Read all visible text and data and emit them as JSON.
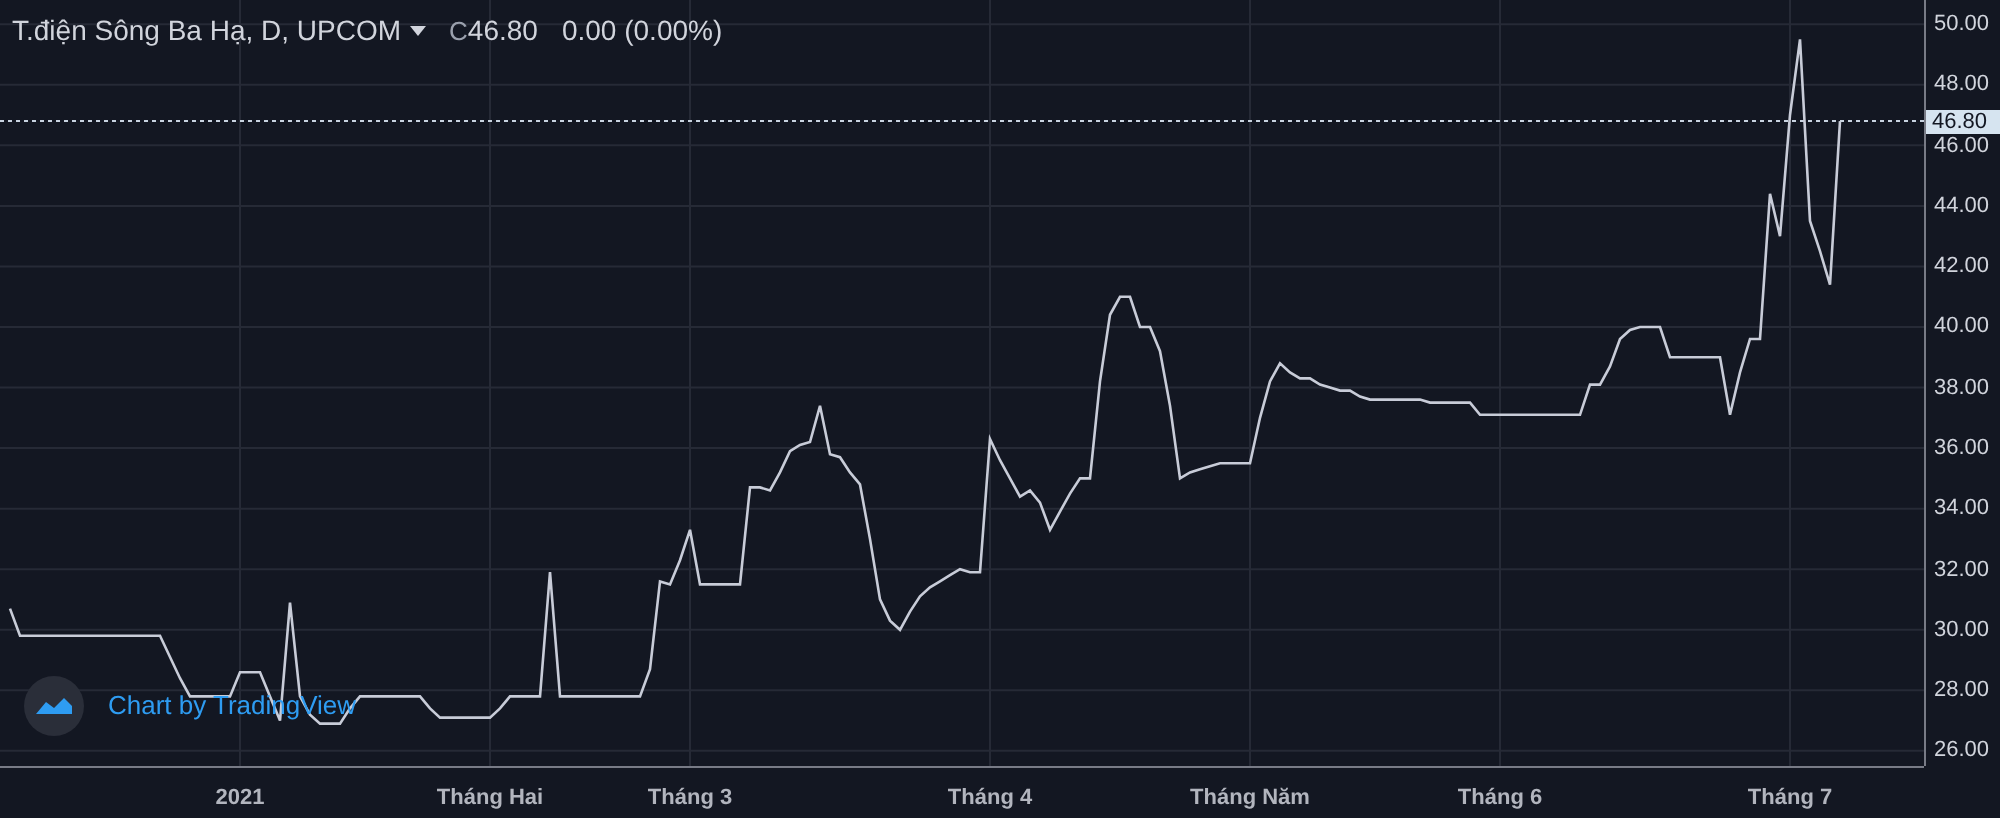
{
  "header": {
    "title": "T.điện Sông Ba Hạ, D, UPCOM",
    "close_prefix": "C",
    "close": "46.80",
    "change": "0.00 (0.00%)"
  },
  "price_label": "46.80",
  "attribution": "Chart by TradingView",
  "chart_data": {
    "type": "line",
    "grid": true,
    "ylim": [
      25.5,
      50.8
    ],
    "ref_lines": [
      {
        "axis": "y",
        "value": 46.8
      }
    ],
    "yticks": [
      {
        "value": 26,
        "label": "26.00"
      },
      {
        "value": 28,
        "label": "28.00"
      },
      {
        "value": 30,
        "label": "30.00"
      },
      {
        "value": 32,
        "label": "32.00"
      },
      {
        "value": 34,
        "label": "34.00"
      },
      {
        "value": 36,
        "label": "36.00"
      },
      {
        "value": 38,
        "label": "38.00"
      },
      {
        "value": 40,
        "label": "40.00"
      },
      {
        "value": 42,
        "label": "42.00"
      },
      {
        "value": 44,
        "label": "44.00"
      },
      {
        "value": 46,
        "label": "46.00"
      },
      {
        "value": 48,
        "label": "48.00"
      },
      {
        "value": 50,
        "label": "50.00"
      }
    ],
    "categories": [
      null,
      null,
      null,
      null,
      null,
      null,
      null,
      null,
      null,
      null,
      null,
      null,
      null,
      null,
      null,
      null,
      null,
      null,
      null,
      null,
      null,
      null,
      null,
      "2021",
      null,
      null,
      null,
      null,
      null,
      null,
      null,
      null,
      null,
      null,
      null,
      null,
      null,
      null,
      null,
      null,
      null,
      null,
      null,
      null,
      null,
      null,
      null,
      null,
      "Tháng Hai",
      null,
      null,
      null,
      null,
      null,
      null,
      null,
      null,
      null,
      null,
      null,
      null,
      null,
      null,
      null,
      null,
      null,
      null,
      null,
      "Tháng 3",
      null,
      null,
      null,
      null,
      null,
      null,
      null,
      null,
      null,
      null,
      null,
      null,
      null,
      null,
      null,
      null,
      null,
      null,
      null,
      null,
      null,
      null,
      null,
      null,
      null,
      null,
      null,
      null,
      null,
      "Tháng 4",
      null,
      null,
      null,
      null,
      null,
      null,
      null,
      null,
      null,
      null,
      null,
      null,
      null,
      null,
      null,
      null,
      null,
      null,
      null,
      null,
      null,
      null,
      null,
      null,
      null,
      "Tháng Năm",
      null,
      null,
      null,
      null,
      null,
      null,
      null,
      null,
      null,
      null,
      null,
      null,
      null,
      null,
      null,
      null,
      null,
      null,
      null,
      null,
      null,
      null,
      null,
      null,
      "Tháng 6",
      null,
      null,
      null,
      null,
      null,
      null,
      null,
      null,
      null,
      null,
      null,
      null,
      null,
      null,
      null,
      null,
      null,
      null,
      null,
      null,
      null,
      null,
      null,
      null,
      null,
      null,
      null,
      null,
      "Tháng 7",
      null,
      null,
      null,
      null,
      null
    ],
    "series": [
      {
        "color": "#c8ccd8",
        "values": [
          30.7,
          29.8,
          29.8,
          29.8,
          29.8,
          29.8,
          29.8,
          29.8,
          29.8,
          29.8,
          29.8,
          29.8,
          29.8,
          29.8,
          29.8,
          29.8,
          29.1,
          28.4,
          27.8,
          27.8,
          27.8,
          27.8,
          27.8,
          28.6,
          28.6,
          28.6,
          27.8,
          27,
          30.9,
          27.8,
          27.2,
          26.9,
          26.9,
          26.9,
          27.4,
          27.8,
          27.8,
          27.8,
          27.8,
          27.8,
          27.8,
          27.8,
          27.4,
          27.1,
          27.1,
          27.1,
          27.1,
          27.1,
          27.1,
          27.4,
          27.8,
          27.8,
          27.8,
          27.8,
          31.9,
          27.8,
          27.8,
          27.8,
          27.8,
          27.8,
          27.8,
          27.8,
          27.8,
          27.8,
          28.7,
          31.6,
          31.5,
          32.3,
          33.3,
          31.5,
          31.5,
          31.5,
          31.5,
          31.5,
          34.7,
          34.7,
          34.6,
          35.2,
          35.9,
          36.1,
          36.2,
          37.4,
          35.8,
          35.7,
          35.2,
          34.8,
          33,
          31,
          30.3,
          30,
          30.6,
          31.1,
          31.4,
          31.6,
          31.8,
          32,
          31.9,
          31.9,
          36.3,
          35.6,
          35,
          34.4,
          34.6,
          34.2,
          33.3,
          33.9,
          34.5,
          35,
          35,
          38.2,
          40.4,
          41,
          41,
          40,
          40,
          39.2,
          37.4,
          35,
          35.2,
          35.3,
          35.4,
          35.5,
          35.5,
          35.5,
          35.5,
          37,
          38.2,
          38.8,
          38.5,
          38.3,
          38.3,
          38.1,
          38,
          37.9,
          37.9,
          37.7,
          37.6,
          37.6,
          37.6,
          37.6,
          37.6,
          37.6,
          37.5,
          37.5,
          37.5,
          37.5,
          37.5,
          37.1,
          37.1,
          37.1,
          37.1,
          37.1,
          37.1,
          37.1,
          37.1,
          37.1,
          37.1,
          37.1,
          38.1,
          38.1,
          38.7,
          39.6,
          39.9,
          40,
          40,
          40,
          39,
          39,
          39,
          39,
          39,
          39,
          37.1,
          38.5,
          39.6,
          39.6,
          44.4,
          43,
          47,
          49.5,
          43.5,
          42.5,
          41.4,
          46.8
        ]
      }
    ]
  }
}
